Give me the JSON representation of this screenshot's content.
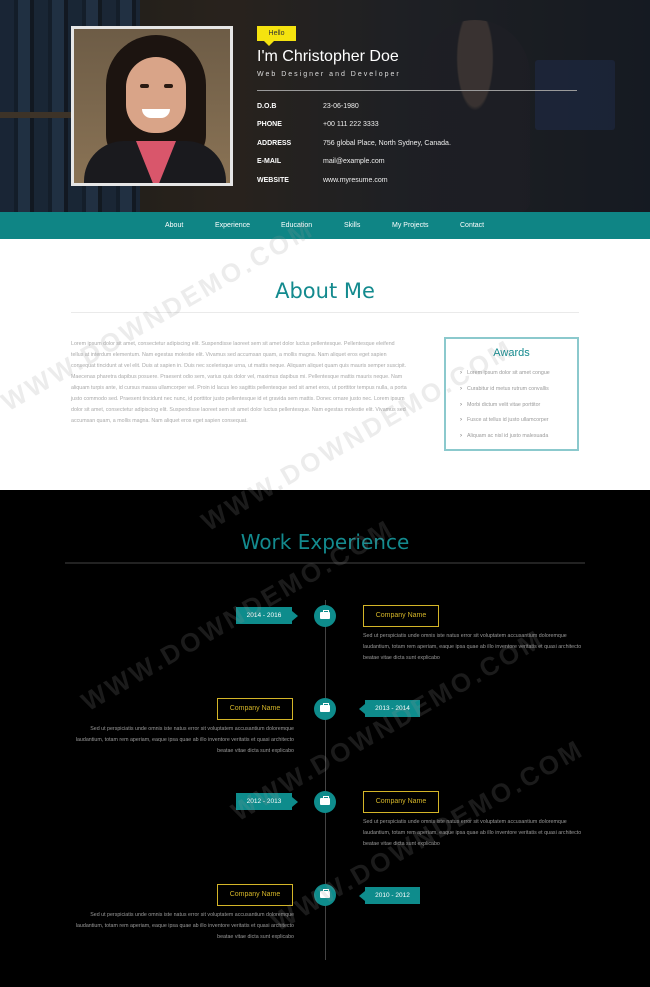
{
  "hero": {
    "badge": "Hello",
    "name": "I'm Christopher Doe",
    "role": "Web Designer and Developer",
    "info": [
      {
        "key": "D.O.B",
        "value": "23-06-1980"
      },
      {
        "key": "PHONE",
        "value": "+00 111 222 3333"
      },
      {
        "key": "ADDRESS",
        "value": "756 global Place, North Sydney, Canada."
      },
      {
        "key": "E-MAIL",
        "value": "mail@example.com"
      },
      {
        "key": "WEBSITE",
        "value": "www.myresume.com"
      }
    ]
  },
  "nav": {
    "items": [
      "About",
      "Experience",
      "Education",
      "Skills",
      "My Projects",
      "Contact"
    ]
  },
  "about": {
    "title": "About Me",
    "text": "Lorem ipsum dolor sit amet, consectetur adipiscing elit. Suspendisse laoreet sem sit amet dolor luctus pellentesque. Pellentesque eleifend tellus at interdum elementum. Nam egestas molestie elit. Vivamus sed accumsan quam, a mollis magna. Nam aliquet eros eget sapien consequat tincidunt at vel elit. Duis at sapien in. Duis nec scelerisque urna, ut mattis neque. Aliquam aliquet quam quis mauris semper suscipit. Maecenas pharetra dapibus posuere. Praesent odio sem, varius quis dolor vel, maximus dapibus mi. Pellentesque mattis mauris neque. Nam aliquam turpis ante, id cursus massa ullamcorper vel. Proin id lacus leo sagittis pellentesque sed sit amet eros, ut porttitor tempus nulla, a porta justo commodo sed. Praesent tincidunt nec nunc, id porttitor justo pellentesque id et gravida sem mattis. Donec ornare justo nec. Lorem ipsum dolor sit amet, consectetur adipiscing elit. Suspendisse laoreet sem sit amet dolor luctus pellentesque. Nam egestas molestie elit. Vivamus sed accumsan quam, a mollis magna. Nam aliquet eros eget sapien consequat.",
    "awards_title": "Awards",
    "awards": [
      "Lorem ipsum dolor sit amet congue",
      "Curabitur id metus rutrum convallis",
      "Morbi dictum velit vitae porttitor",
      "Fusce at tellus id justo ullamcorper",
      "Aliquam ac nisl id justo malesuada"
    ]
  },
  "work": {
    "title": "Work Experience",
    "entries": [
      {
        "date": "2014 - 2016",
        "company": "Company Name",
        "text": "Sed ut perspiciatis unde omnis iste natus error sit voluptatem accusantium doloremque laudantium, totam rem aperiam, eaque ipsa quae ab illo inventore veritatis et quasi architecto beatae vitae dicta sunt explicabo"
      },
      {
        "date": "2013 - 2014",
        "company": "Company Name",
        "text": "Sed ut perspiciatis unde omnis iste natus error sit voluptatem accusantium doloremque laudantium, totam rem aperiam, eaque ipsa quae ab illo inventore veritatis et quasi architecto beatae vitae dicta sunt explicabo"
      },
      {
        "date": "2012 - 2013",
        "company": "Company Name",
        "text": "Sed ut perspiciatis unde omnis iste natus error sit voluptatem accusantium doloremque laudantium, totam rem aperiam, eaque ipsa quae ab illo inventore veritatis et quasi architecto beatae vitae dicta sunt explicabo"
      },
      {
        "date": "2010 - 2012",
        "company": "Company Name",
        "text": "Sed ut perspiciatis unde omnis iste natus error sit voluptatem accusantium doloremque laudantium, totam rem aperiam, eaque ipsa quae ab illo inventore veritatis et quasi architecto beatae vitae dicta sunt explicabo"
      }
    ]
  },
  "watermark": "WWW.DOWNDEMO.COM",
  "colors": {
    "teal": "#0f8585",
    "accent_yellow": "#f5e30f",
    "company_gold": "#d4b528"
  }
}
